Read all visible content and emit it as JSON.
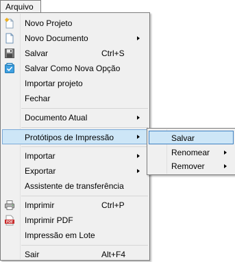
{
  "menubar": {
    "label": "Arquivo"
  },
  "menu": {
    "items": [
      {
        "label": "Novo Projeto",
        "icon": "new-project-icon"
      },
      {
        "label": "Novo Documento",
        "icon": "new-document-icon"
      },
      {
        "label": "Salvar",
        "shortcut": "Ctrl+S",
        "icon": "save-icon"
      },
      {
        "label": "Salvar Como Nova Opção",
        "icon": "save-as-option-icon"
      },
      {
        "label": "Importar projeto"
      },
      {
        "label": "Fechar"
      },
      {
        "label": "Documento Atual"
      },
      {
        "label": "Protótipos de Impressão"
      },
      {
        "label": "Importar"
      },
      {
        "label": "Exportar"
      },
      {
        "label": "Assistente de transferência"
      },
      {
        "label": "Imprimir",
        "shortcut": "Ctrl+P",
        "icon": "printer-icon"
      },
      {
        "label": "Imprimir PDF",
        "icon": "pdf-icon"
      },
      {
        "label": "Impressão em Lote"
      },
      {
        "label": "Sair",
        "shortcut": "Alt+F4"
      }
    ]
  },
  "submenu": {
    "items": [
      {
        "label": "Salvar"
      },
      {
        "label": "Renomear"
      },
      {
        "label": "Remover"
      }
    ]
  },
  "colors": {
    "highlight": "#cde6f7",
    "highlight_border": "#7aa9d8",
    "menu_bg": "#f0f0f0"
  }
}
